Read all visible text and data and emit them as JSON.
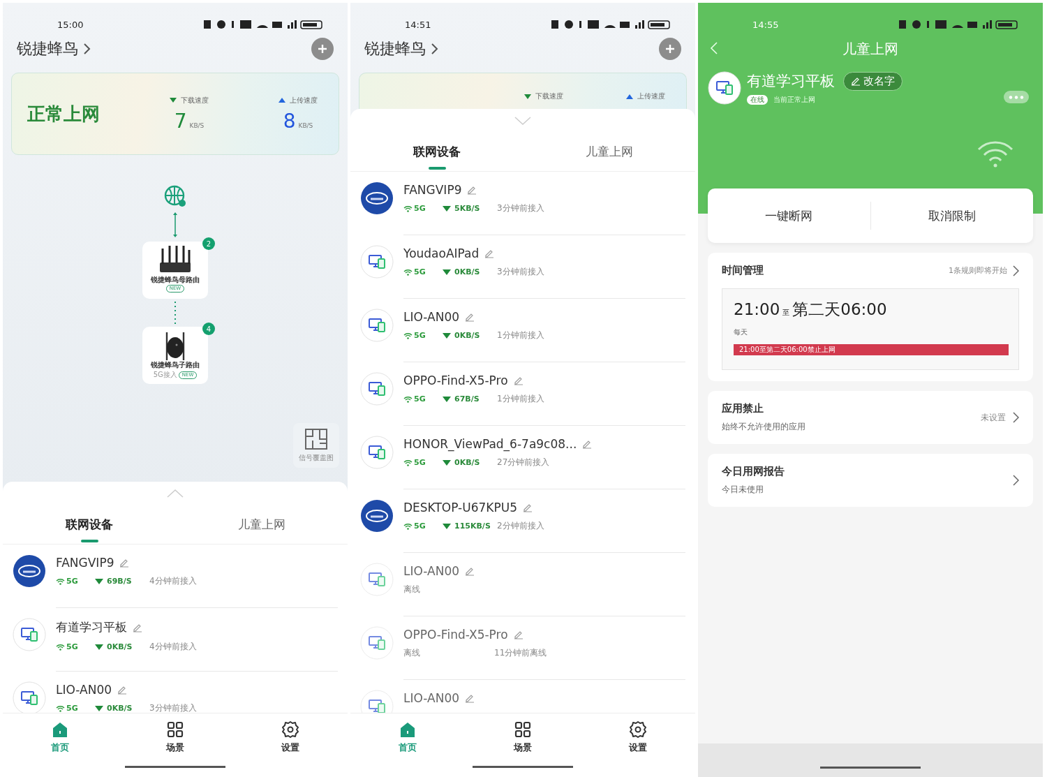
{
  "screens": [
    {
      "kind": "home",
      "status_time": "15:00",
      "network_name": "锐捷蜂鸟",
      "status_card": {
        "state": "正常上网",
        "download_label": "下载速度",
        "download_value": "7",
        "download_unit": "KB/S",
        "upload_label": "上传速度",
        "upload_value": "8",
        "upload_unit": "KB/S"
      },
      "topology": [
        {
          "kind": "main",
          "name": "锐捷蜂鸟母路由",
          "badge": "NEW",
          "count": "2"
        },
        {
          "kind": "satellite",
          "name": "锐捷蜂鸟子路由",
          "note": "5G接入",
          "badge": "NEW",
          "count": "4"
        }
      ],
      "coverage_button": "信号覆盖图",
      "sheet": {
        "expanded": false,
        "tabs": [
          {
            "label": "联网设备",
            "selected": true
          },
          {
            "label": "儿童上网",
            "selected": false
          }
        ],
        "devices": [
          {
            "kind": "chip",
            "name": "FANGVIP9",
            "online": true,
            "band": "5G",
            "speed": "69B/S",
            "time": "4分钟前接入"
          },
          {
            "kind": "devices",
            "name": "有道学习平板",
            "online": true,
            "band": "5G",
            "speed": "0KB/S",
            "time": "4分钟前接入"
          },
          {
            "kind": "devices",
            "name": "LIO-AN00",
            "online": true,
            "band": "5G",
            "speed": "0KB/S",
            "time": "3分钟前接入"
          }
        ]
      },
      "nav": [
        {
          "kind": "home",
          "label": "首页",
          "selected": true
        },
        {
          "kind": "grid",
          "label": "场景",
          "selected": false
        },
        {
          "kind": "gear",
          "label": "设置",
          "selected": false
        }
      ]
    },
    {
      "kind": "home",
      "status_time": "14:51",
      "network_name": "锐捷蜂鸟",
      "status_card": {
        "download_label": "下载速度",
        "upload_label": "上传速度"
      },
      "sheet": {
        "expanded": true,
        "tabs": [
          {
            "label": "联网设备",
            "selected": true
          },
          {
            "label": "儿童上网",
            "selected": false
          }
        ],
        "devices": [
          {
            "kind": "chip",
            "name": "FANGVIP9",
            "online": true,
            "band": "5G",
            "speed": "5KB/S",
            "time": "3分钟前接入"
          },
          {
            "kind": "devices",
            "name": "YoudaoAIPad",
            "online": true,
            "band": "5G",
            "speed": "0KB/S",
            "time": "3分钟前接入"
          },
          {
            "kind": "devices",
            "name": "LIO-AN00",
            "online": true,
            "band": "5G",
            "speed": "0KB/S",
            "time": "1分钟前接入"
          },
          {
            "kind": "devices",
            "name": "OPPO-Find-X5-Pro",
            "online": true,
            "band": "5G",
            "speed": "67B/S",
            "time": "1分钟前接入"
          },
          {
            "kind": "devices",
            "name": "HONOR_ViewPad_6-7a9c08...",
            "online": true,
            "band": "5G",
            "speed": "0KB/S",
            "time": "27分钟前接入"
          },
          {
            "kind": "chip",
            "name": "DESKTOP-U67KPU5",
            "online": true,
            "band": "5G",
            "speed": "115KB/S",
            "time": "2分钟前接入"
          },
          {
            "kind": "devices",
            "name": "LIO-AN00",
            "online": false,
            "status": "离线"
          },
          {
            "kind": "devices",
            "name": "OPPO-Find-X5-Pro",
            "online": false,
            "status": "离线",
            "time": "11分钟前离线"
          },
          {
            "kind": "devices",
            "name": "LIO-AN00",
            "online": false
          }
        ]
      },
      "nav": [
        {
          "kind": "home",
          "label": "首页",
          "selected": true
        },
        {
          "kind": "grid",
          "label": "场景",
          "selected": false
        },
        {
          "kind": "gear",
          "label": "设置",
          "selected": false
        }
      ]
    },
    {
      "kind": "child_detail",
      "status_time": "14:55",
      "title": "儿童上网",
      "device": {
        "name": "有道学习平板",
        "rename": "改名字",
        "online_badge": "在线",
        "status": "当前正常上网"
      },
      "actions": [
        "一键断网",
        "取消限制"
      ],
      "cards": [
        {
          "kind": "schedule",
          "title": "时间管理",
          "hint": "1条规则即将开始",
          "start": "21:00",
          "to": "至",
          "end": "第二天06:00",
          "repeat": "每天",
          "bar": "21:00至第二天06:00禁止上网"
        },
        {
          "kind": "setting",
          "title": "应用禁止",
          "subtitle": "始终不允许使用的应用",
          "value": "未设置"
        },
        {
          "kind": "setting",
          "title": "今日用网报告",
          "subtitle": "今日未使用"
        }
      ]
    }
  ]
}
